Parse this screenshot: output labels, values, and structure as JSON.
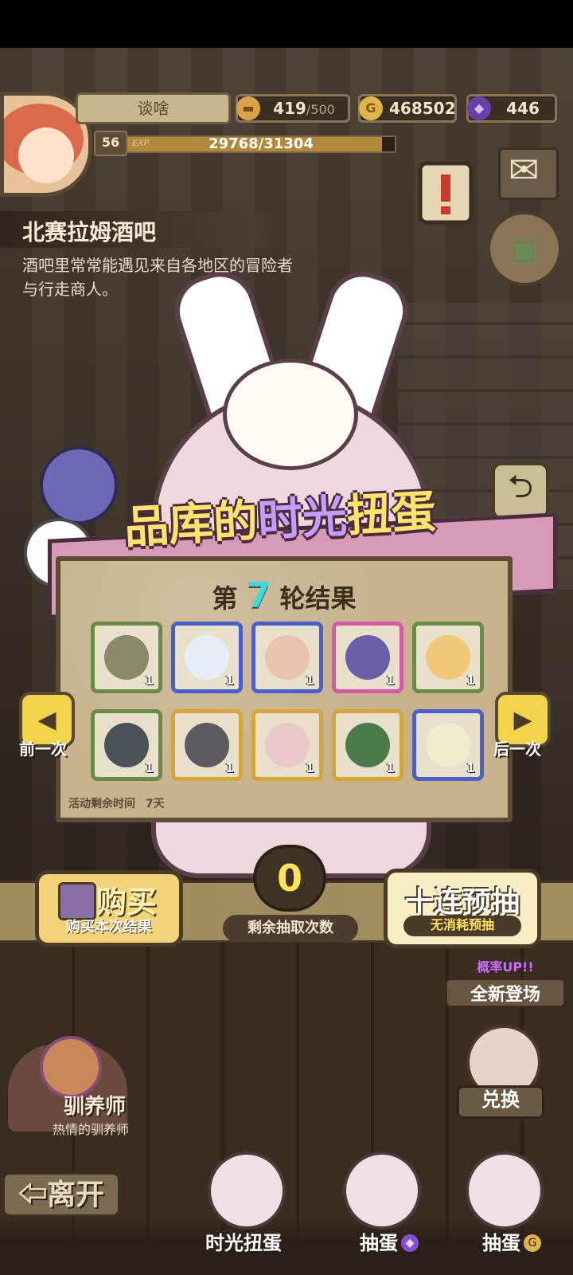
{
  "player": {
    "name": "谈啥",
    "level": "56",
    "exp_label": "EXP",
    "exp_text": "29768/31304",
    "exp_fraction": 0.951
  },
  "resources": {
    "stamina": {
      "value": "419",
      "max": "/500",
      "icon": "bread-icon"
    },
    "gold": {
      "value": "468502",
      "icon": "gold-coin-icon"
    },
    "gems": {
      "value": "446",
      "icon": "purple-gem-icon"
    }
  },
  "location": {
    "title": "北赛拉姆酒吧",
    "description": "酒吧里常常能遇见来自各地区的冒险者与行走商人。"
  },
  "event": {
    "title_pre": "品库的",
    "title_highlight": "时光",
    "title_post": "扭蛋",
    "round_prefix": "第",
    "round_number": "7",
    "round_suffix": "轮结果",
    "time_left_label": "活动剩余时间",
    "time_left_value": "7天"
  },
  "items": [
    {
      "name": "leaf-item",
      "rarity": "green",
      "count": "1",
      "color": "#8a8a6a"
    },
    {
      "name": "white-egg-item",
      "rarity": "blue",
      "count": "1",
      "color": "#e8eef8"
    },
    {
      "name": "bag-item",
      "rarity": "blue",
      "count": "1",
      "color": "#e8c4b0"
    },
    {
      "name": "winged-egg-item",
      "rarity": "pink",
      "count": "1",
      "color": "#6a5ea8"
    },
    {
      "name": "gold-egg-item",
      "rarity": "green",
      "count": "1",
      "color": "#f0c878"
    },
    {
      "name": "turtle-shell-item",
      "rarity": "green",
      "count": "1",
      "color": "#4a5258"
    },
    {
      "name": "stone-egg-item",
      "rarity": "gold",
      "count": "1",
      "color": "#5a5a60"
    },
    {
      "name": "flower-item",
      "rarity": "gold",
      "count": "1",
      "color": "#e8c8c8"
    },
    {
      "name": "lantern-item",
      "rarity": "gold",
      "count": "1",
      "color": "#4a7a4a"
    },
    {
      "name": "crystal-egg-item",
      "rarity": "blue",
      "count": "1",
      "color": "#f0ecd0"
    }
  ],
  "nav": {
    "prev_label": "前一次",
    "next_label": "后一次"
  },
  "actions": {
    "buy_main": "购买",
    "buy_sub": "购买本次结果",
    "remaining_count": "0",
    "remaining_label": "剩余抽取次数",
    "ten_main": "十连预抽",
    "ten_sub": "无消耗预抽"
  },
  "promo": {
    "top": "概率UP!!",
    "bottom": "全新登场"
  },
  "npc": {
    "title": "驯养师",
    "subtitle": "热情的驯养师"
  },
  "leave_label": "离开",
  "exchange_label": "兑换",
  "tabs": [
    {
      "label": "时光扭蛋"
    },
    {
      "label": "抽蛋",
      "currency_icon": "purple-gem-icon"
    },
    {
      "label": "抽蛋",
      "currency_icon": "gold-coin-icon"
    }
  ]
}
